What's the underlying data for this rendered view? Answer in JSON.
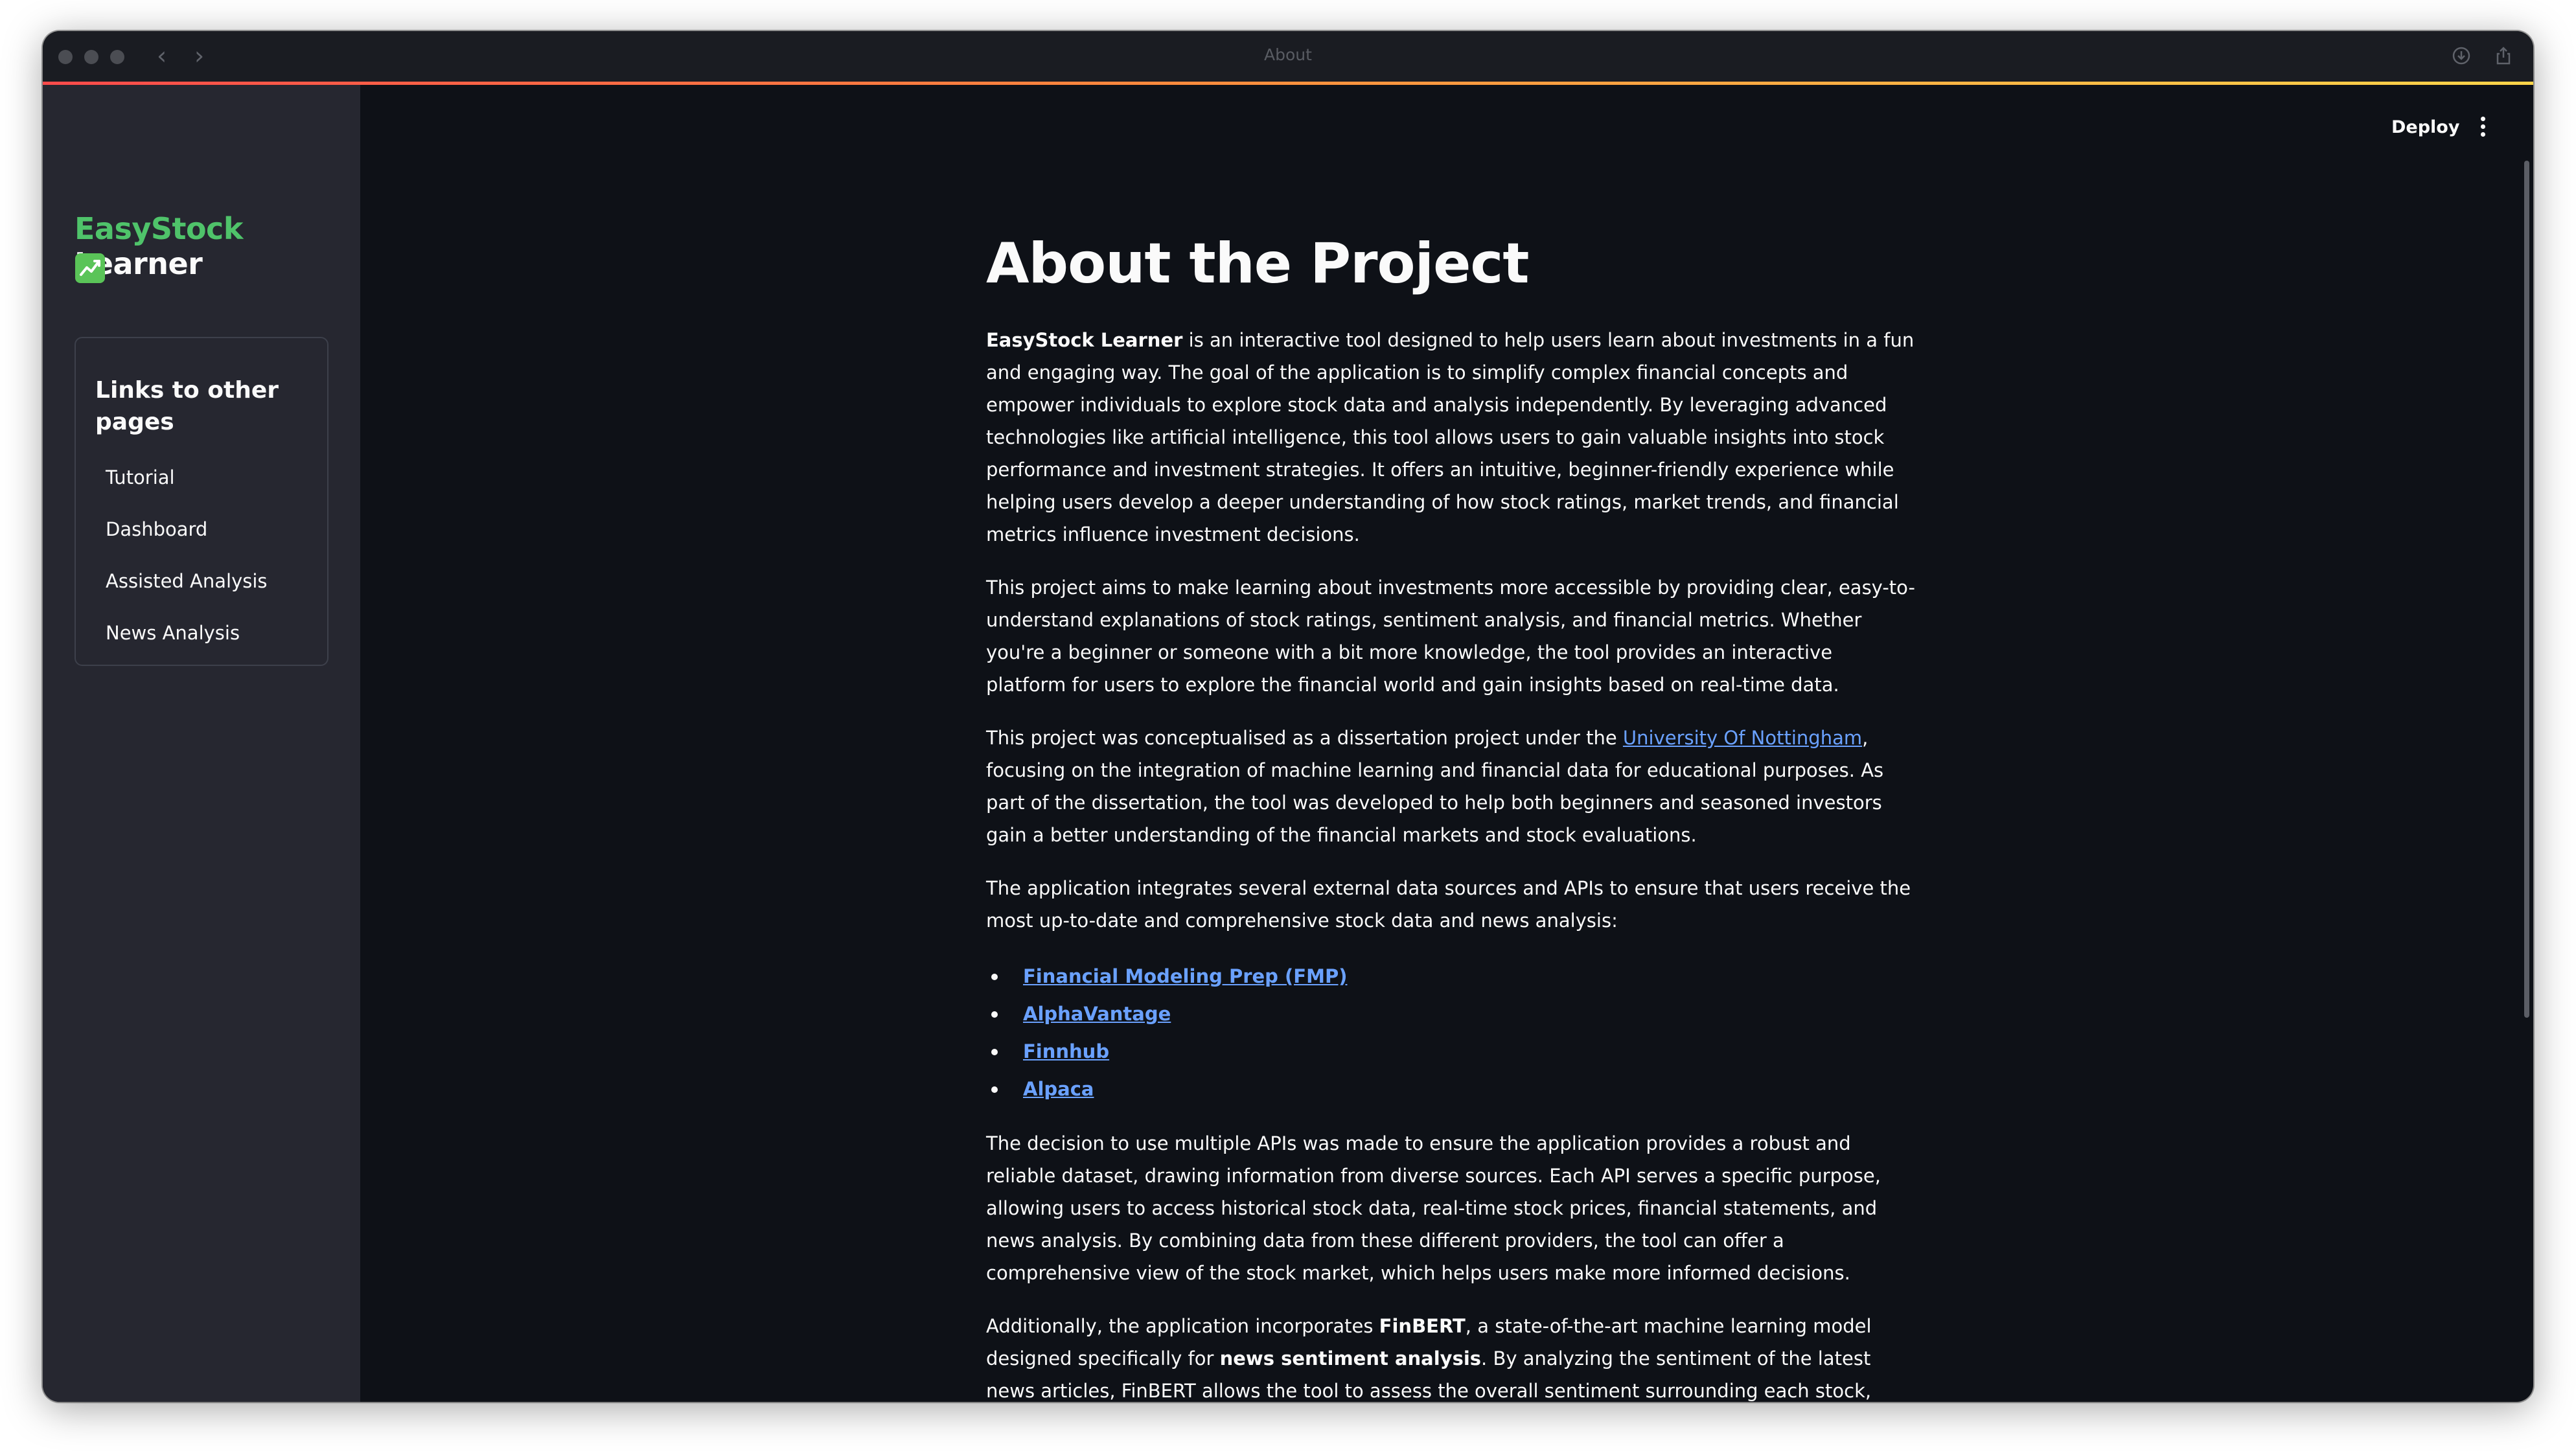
{
  "window": {
    "title": "About"
  },
  "header": {
    "deploy_label": "Deploy"
  },
  "sidebar": {
    "brand_part1": "EasyStock",
    "brand_part2": " Learner",
    "brand_icon": "chart-increasing-emoji",
    "links_heading": "Links to other pages",
    "items": [
      {
        "label": "Tutorial"
      },
      {
        "label": "Dashboard"
      },
      {
        "label": "Assisted Analysis"
      },
      {
        "label": "News Analysis"
      }
    ]
  },
  "main": {
    "title": "About the Project",
    "p1": {
      "bold": "EasyStock Learner",
      "text": " is an interactive tool designed to help users learn about investments in a fun and engaging way. The goal of the application is to simplify complex financial concepts and empower individuals to explore stock data and analysis independently. By leveraging advanced technologies like artificial intelligence, this tool allows users to gain valuable insights into stock performance and investment strategies. It offers an intuitive, beginner-friendly experience while helping users develop a deeper understanding of how stock ratings, market trends, and financial metrics influence investment decisions."
    },
    "p2": "This project aims to make learning about investments more accessible by providing clear, easy-to-understand explanations of stock ratings, sentiment analysis, and financial metrics. Whether you're a beginner or someone with a bit more knowledge, the tool provides an interactive platform for users to explore the financial world and gain insights based on real-time data.",
    "p3": {
      "before": "This project was conceptualised as a dissertation project under the ",
      "link": "University Of Nottingham",
      "after": ", focusing on the integration of machine learning and financial data for educational purposes. As part of the dissertation, the tool was developed to help both beginners and seasoned investors gain a better understanding of the financial markets and stock evaluations."
    },
    "p4": "The application integrates several external data sources and APIs to ensure that users receive the most up-to-date and comprehensive stock data and news analysis:",
    "apis": [
      {
        "label": "Financial Modeling Prep (FMP)"
      },
      {
        "label": "AlphaVantage"
      },
      {
        "label": "Finnhub"
      },
      {
        "label": "Alpaca"
      }
    ],
    "p5": "The decision to use multiple APIs was made to ensure the application provides a robust and reliable dataset, drawing information from diverse sources. Each API serves a specific purpose, allowing users to access historical stock data, real-time stock prices, financial statements, and news analysis. By combining data from these different providers, the tool can offer a comprehensive view of the stock market, which helps users make more informed decisions.",
    "p6": {
      "t1": "Additionally, the application incorporates ",
      "b1": "FinBERT",
      "t2": ", a state-of-the-art machine learning model designed specifically for ",
      "b2": "news sentiment analysis",
      "t3": ". By analyzing the sentiment of the latest news articles, FinBERT allows the tool to assess the overall sentiment surrounding each stock, giving users insights into how the"
    }
  },
  "colors": {
    "background": "#0e1117",
    "sidebar": "#262730",
    "brand_accent": "#4fc36a",
    "link": "#6aa1ff",
    "text": "#fafafa"
  }
}
